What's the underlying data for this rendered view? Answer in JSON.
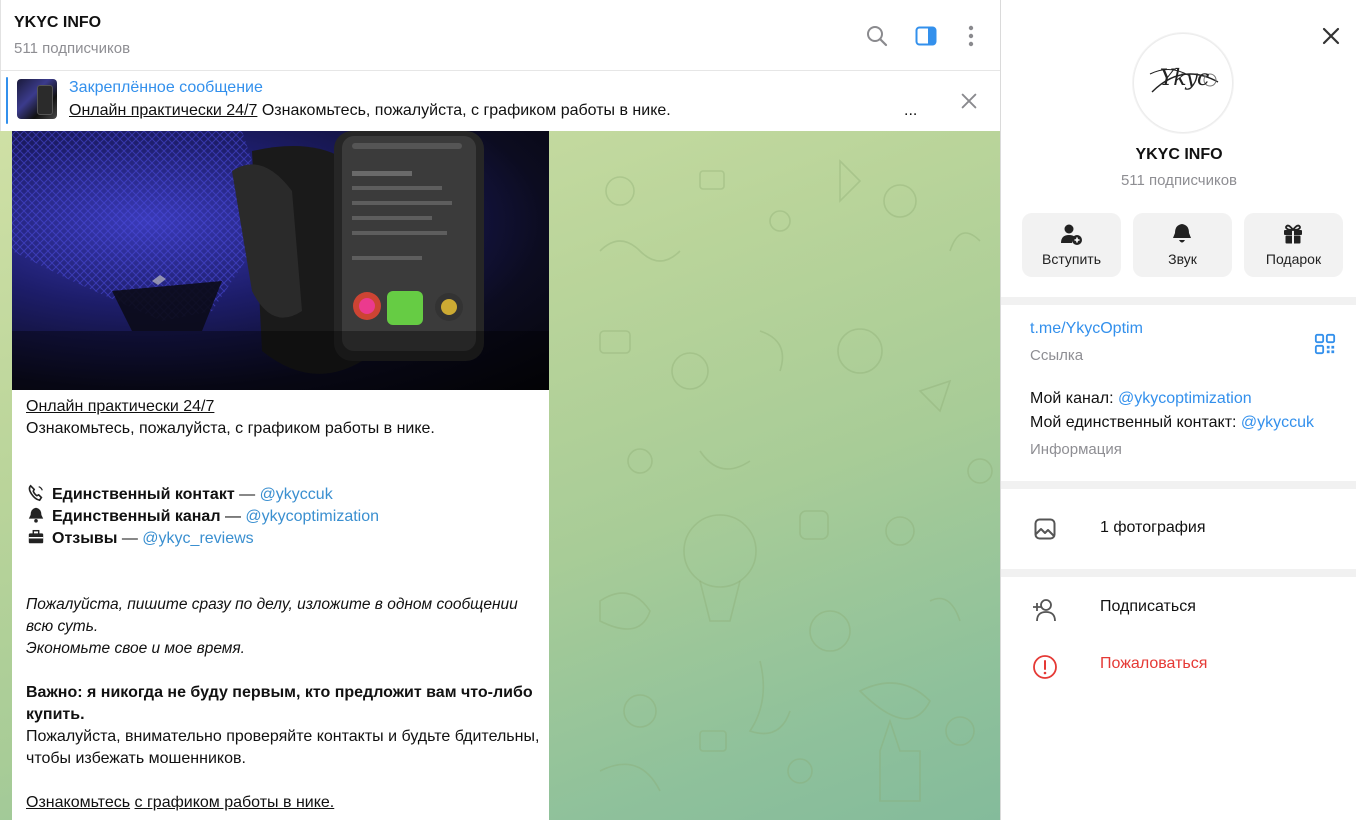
{
  "chat": {
    "title": "YKYC INFO",
    "subscribers": "511 подписчиков",
    "icons": {
      "search": "search-icon",
      "sidebar": "sidebar-toggle-icon",
      "more": "more-vertical-icon"
    }
  },
  "pinned": {
    "label": "Закреплённое сообщение",
    "link_text": "Онлайн практически 24/7",
    "rest_text": " Ознакомьтесь, пожалуйста, с графиком работы в нике.",
    "ellipsis": "...",
    "close_icon": "close-icon"
  },
  "message": {
    "title": "Онлайн практически 24/7",
    "intro": "Ознакомьтесь, пожалуйста, с графиком работы в нике.",
    "contacts": [
      {
        "icon": "phone-emoji-icon",
        "label": "Единственный контакт",
        "sep": "  — ",
        "link": "@ykyccuk"
      },
      {
        "icon": "bell-emoji-icon",
        "label": "Единственный канал",
        "sep": " — ",
        "link": "@ykycoptimization"
      },
      {
        "icon": "briefcase-emoji-icon",
        "label": "Отзывы",
        "sep": " — ",
        "link": "@ykyc_reviews"
      }
    ],
    "italic_text": "Пожалуйста, пишите сразу по делу, изложите в одном сообщении всю суть.",
    "italic_text_2": "Экономьте свое и мое время.",
    "warning_bold": "Важно: я никогда не буду первым, кто предложит вам что-либо купить.",
    "warning_text": "Пожалуйста, внимательно проверяйте контакты и будьте бдительны, чтобы избежать мошенников.",
    "footer_link_1": "Ознакомьтесь",
    "footer_link_2": "с графиком работы в нике."
  },
  "profile": {
    "avatar_text": "Ykyc",
    "name": "YKYC INFO",
    "subscribers": "511 подписчиков",
    "actions": [
      {
        "label": "Вступить",
        "icon": "add-user-icon"
      },
      {
        "label": "Звук",
        "icon": "bell-icon"
      },
      {
        "label": "Подарок",
        "icon": "gift-icon"
      }
    ],
    "link": {
      "value": "t.me/YkycOptim",
      "caption": "Ссылка",
      "icon": "qr-code-icon"
    },
    "about": {
      "line1_text": "Мой канал: ",
      "line1_link": "@ykycoptimization",
      "line2_text": "Мой единственный контакт: ",
      "line2_link": "@ykyccuk",
      "caption": "Информация"
    },
    "photos": {
      "label": "1 фотография",
      "icon": "photo-icon"
    },
    "subscribe": {
      "label": "Подписаться",
      "icon": "add-user-icon"
    },
    "report": {
      "label": "Пожаловаться",
      "icon": "report-icon"
    },
    "close_icon": "close-icon"
  },
  "colors": {
    "accent": "#3390ec",
    "link": "#3a8fd0",
    "danger": "#e53935",
    "muted": "#8e8e93",
    "chat_bg_start": "#cfe0a5",
    "chat_bg_end": "#84bb9b"
  }
}
